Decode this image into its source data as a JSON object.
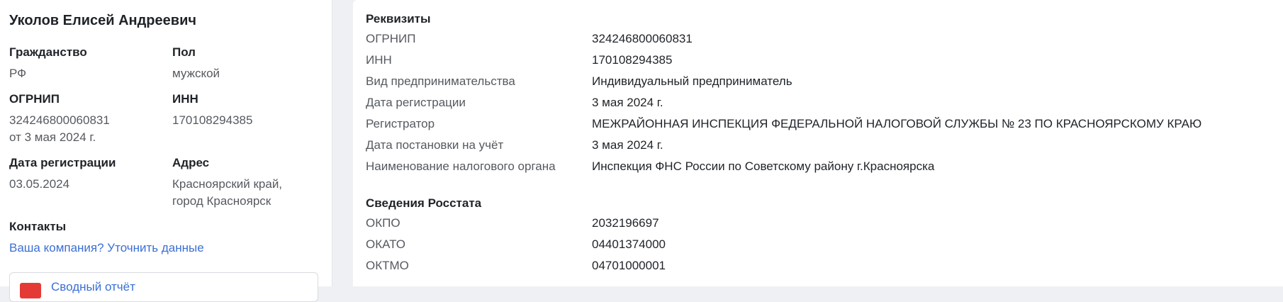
{
  "left": {
    "name": "Уколов Елисей Андреевич",
    "citizenship": {
      "label": "Гражданство",
      "value": "РФ"
    },
    "gender": {
      "label": "Пол",
      "value": "мужской"
    },
    "ogrnip": {
      "label": "ОГРНИП",
      "value": "324246800060831",
      "date": "от 3 мая 2024 г."
    },
    "inn": {
      "label": "ИНН",
      "value": "170108294385"
    },
    "reg_date": {
      "label": "Дата регистрации",
      "value": "03.05.2024"
    },
    "address": {
      "label": "Адрес",
      "line1": "Красноярский край,",
      "line2": "город Красноярск"
    },
    "contacts": {
      "label": "Контакты",
      "link": "Ваша компания? Уточнить данные"
    },
    "snippet": {
      "label": "Сводный отчёт"
    }
  },
  "right": {
    "requisites": {
      "title": "Реквизиты",
      "rows": [
        {
          "label": "ОГРНИП",
          "value": "324246800060831"
        },
        {
          "label": "ИНН",
          "value": "170108294385"
        },
        {
          "label": "Вид предпринимательства",
          "value": "Индивидуальный предприниматель"
        },
        {
          "label": "Дата регистрации",
          "value": "3 мая 2024 г."
        },
        {
          "label": "Регистратор",
          "value": "МЕЖРАЙОННАЯ ИНСПЕКЦИЯ ФЕДЕРАЛЬНОЙ НАЛОГОВОЙ СЛУЖБЫ № 23 ПО КРАСНОЯРСКОМУ КРАЮ"
        },
        {
          "label": "Дата постановки на учёт",
          "value": "3 мая 2024 г."
        },
        {
          "label": "Наименование налогового органа",
          "value": "Инспекция ФНС России по Советскому району г.Красноярска"
        }
      ]
    },
    "rosstat": {
      "title": "Сведения Росстата",
      "rows": [
        {
          "label": "ОКПО",
          "value": "2032196697"
        },
        {
          "label": "ОКАТО",
          "value": "04401374000"
        },
        {
          "label": "ОКТМО",
          "value": "04701000001"
        }
      ]
    }
  }
}
